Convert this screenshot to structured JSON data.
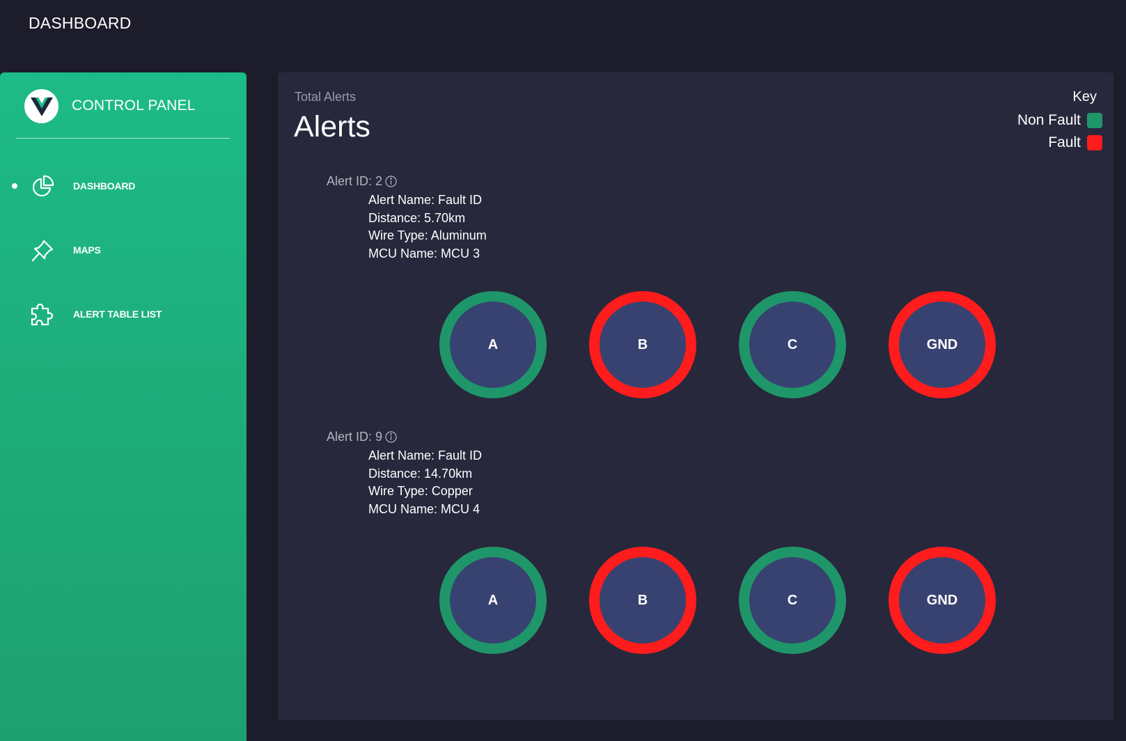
{
  "topbar": {
    "title": "DASHBOARD"
  },
  "sidebar": {
    "brand": {
      "logo_letter": "V",
      "title": "CONTROL PANEL"
    },
    "items": [
      {
        "label": "DASHBOARD",
        "icon": "pie-chart-icon",
        "active": true
      },
      {
        "label": "MAPS",
        "icon": "pin-icon",
        "active": false
      },
      {
        "label": "ALERT TABLE LIST",
        "icon": "puzzle-icon",
        "active": false
      }
    ]
  },
  "colors": {
    "non_fault": "#1e9669",
    "fault": "#ff1c1c",
    "sidebar": "#1dbb87",
    "card": "#27283c",
    "phase_fill": "#384270"
  },
  "main": {
    "subtitle": "Total Alerts",
    "title": "Alerts",
    "key": {
      "title": "Key",
      "items": [
        {
          "label": "Non Fault",
          "color": "#1e9669"
        },
        {
          "label": "Fault",
          "color": "#ff1c1c"
        }
      ]
    },
    "alerts": [
      {
        "id_label": "Alert ID: 2",
        "name": "Alert Name: Fault ID",
        "distance": "Distance: 5.70km",
        "wire_type": "Wire Type: Aluminum",
        "mcu": "MCU Name: MCU 3",
        "phases": [
          {
            "label": "A",
            "status": "non-fault"
          },
          {
            "label": "B",
            "status": "fault"
          },
          {
            "label": "C",
            "status": "non-fault"
          },
          {
            "label": "GND",
            "status": "fault"
          }
        ]
      },
      {
        "id_label": "Alert ID: 9",
        "name": "Alert Name: Fault ID",
        "distance": "Distance: 14.70km",
        "wire_type": "Wire Type: Copper",
        "mcu": "MCU Name: MCU 4",
        "phases": [
          {
            "label": "A",
            "status": "non-fault"
          },
          {
            "label": "B",
            "status": "fault"
          },
          {
            "label": "C",
            "status": "non-fault"
          },
          {
            "label": "GND",
            "status": "fault"
          }
        ]
      }
    ]
  }
}
